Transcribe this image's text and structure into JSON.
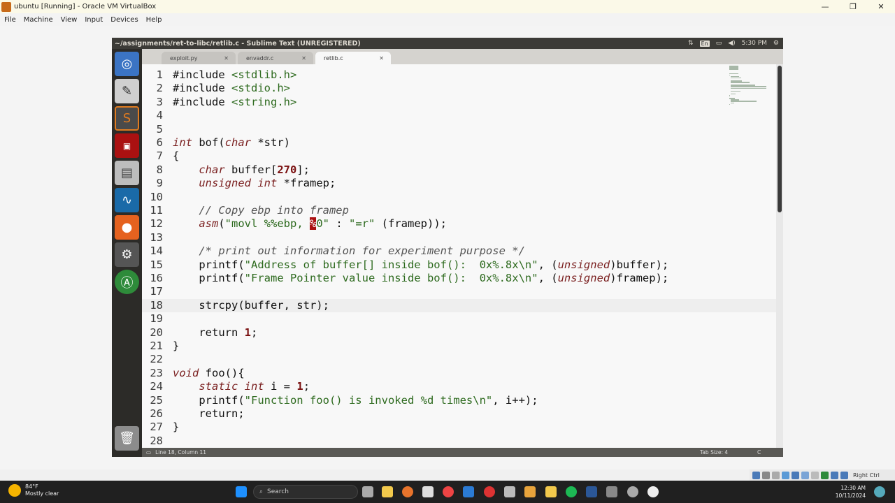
{
  "host_window": {
    "title": "ubuntu [Running] - Oracle VM VirtualBox",
    "menu": [
      "File",
      "Machine",
      "View",
      "Input",
      "Devices",
      "Help"
    ]
  },
  "guest": {
    "window_title": "~/assignments/ret-to-libc/retlib.c - Sublime Text (UNREGISTERED)",
    "keyboard_layout": "En",
    "time": "5:30 PM",
    "tabs": [
      {
        "label": "exploit.py"
      },
      {
        "label": "envaddr.c"
      },
      {
        "label": "retlib.c"
      }
    ],
    "status": {
      "position": "Line 18, Column 11",
      "tab_size": "Tab Size: 4",
      "syntax": "C"
    },
    "line_numbers": [
      "1",
      "2",
      "3",
      "4",
      "5",
      "6",
      "7",
      "8",
      "9",
      "10",
      "11",
      "12",
      "13",
      "14",
      "15",
      "16",
      "17",
      "18",
      "19",
      "20",
      "21",
      "22",
      "23",
      "24",
      "25",
      "26",
      "27",
      "28"
    ],
    "code_lines": [
      "#include <stdlib.h>",
      "#include <stdio.h>",
      "#include <string.h>",
      "",
      "",
      "int bof(char *str)",
      "{",
      "    char buffer[270];",
      "    unsigned int *framep;",
      "",
      "    // Copy ebp into framep",
      "    asm(\"movl %%ebp, %0\" : \"=r\" (framep));",
      "",
      "    /* print out information for experiment purpose */",
      "    printf(\"Address of buffer[] inside bof():  0x%.8x\\n\", (unsigned)buffer);",
      "    printf(\"Frame Pointer value inside bof():  0x%.8x\\n\", (unsigned)framep);",
      "",
      "    strcpy(buffer, str);",
      "",
      "    return 1;",
      "}",
      "",
      "void foo(){",
      "    static int i = 1;",
      "    printf(\"Function foo() is invoked %d times\\n\", i++);",
      "    return;",
      "}",
      ""
    ],
    "current_line": 18
  },
  "taskbar": {
    "weather_temp": "84°F",
    "weather_desc": "Mostly clear",
    "search_label": "Search",
    "clock_time": "12:30 AM",
    "clock_date": "10/11/2024",
    "host_key": "Right Ctrl"
  },
  "colors": {
    "keyword": "#7a1f1f",
    "string": "#2d6a1e",
    "number": "#7a1010",
    "comment": "#555555",
    "highlight": "#aa1111"
  }
}
